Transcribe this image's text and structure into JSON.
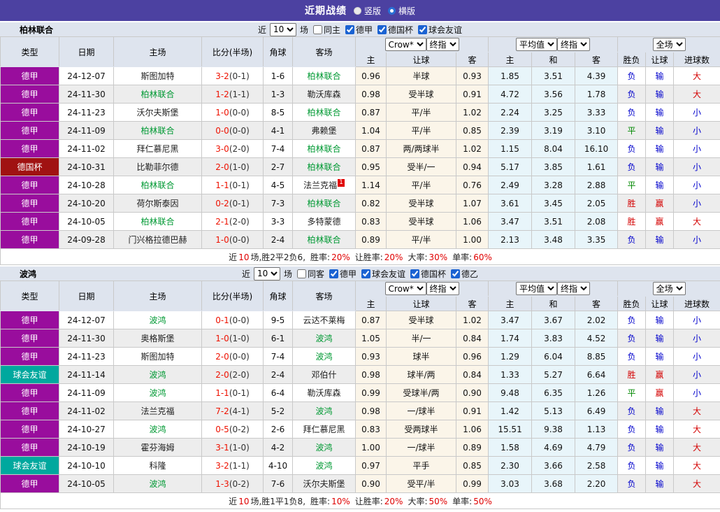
{
  "colors": {
    "topbar_bg": "#4c41a1",
    "panel_bg": "#dee4ee",
    "odds_bg": "#fbf5e9",
    "avg_bg": "#e8f5fa",
    "focus_green": "#009933",
    "score_red": "#ee1100",
    "stat_red": "#e00000",
    "league_colors": {
      "德甲": "#990d9d",
      "德国杯": "#a01212",
      "球会友谊": "#00a89e",
      "德乙": "#1a62d2"
    },
    "result_palette": {
      "red": "#d40000",
      "green": "#008800",
      "blue": "#0000cc"
    }
  },
  "result_color_map": {
    "胜": "red",
    "平": "green",
    "负": "blue",
    "赢": "red",
    "输": "blue",
    "大": "red",
    "小": "blue"
  },
  "topbar": {
    "title": "近期战绩",
    "radios": [
      {
        "label": "竖版",
        "selected": false
      },
      {
        "label": "横版",
        "selected": true
      }
    ]
  },
  "columns": [
    "类型",
    "日期",
    "主场",
    "比分(半场)",
    "角球",
    "客场",
    "主",
    "让球",
    "客",
    "主",
    "和",
    "客",
    "胜负",
    "让球",
    "进球数"
  ],
  "teams": [
    {
      "name": "柏林联合",
      "filter": {
        "near_label": "近",
        "games_value": "10",
        "games_label": "场",
        "same_label": "同主",
        "same_checked": false,
        "leagues": [
          {
            "label": "德甲",
            "checked": true
          },
          {
            "label": "德国杯",
            "checked": true
          },
          {
            "label": "球会友谊",
            "checked": true
          }
        ]
      },
      "dropdowns": {
        "odds_source": "Crow*",
        "odds_final": "终指",
        "avg": "平均值",
        "avg_final": "终指",
        "scope": "全场"
      },
      "rows": [
        {
          "league": "德甲",
          "date": "24-12-07",
          "home": "斯图加特",
          "score": "3-2",
          "half": "0-1",
          "corners": "1-6",
          "away": "柏林联合",
          "focus": "away",
          "home_odds": "0.96",
          "handicap": "半球",
          "away_odds": "0.93",
          "avg_home": "1.85",
          "avg_draw": "3.51",
          "avg_away": "4.39",
          "result": "负",
          "handicap_result": "输",
          "goals_result": "大"
        },
        {
          "league": "德甲",
          "date": "24-11-30",
          "home": "柏林联合",
          "score": "1-2",
          "half": "1-1",
          "corners": "1-3",
          "away": "勒沃库森",
          "focus": "home",
          "home_odds": "0.98",
          "handicap": "受半球",
          "away_odds": "0.91",
          "avg_home": "4.72",
          "avg_draw": "3.56",
          "avg_away": "1.78",
          "result": "负",
          "handicap_result": "输",
          "goals_result": "大"
        },
        {
          "league": "德甲",
          "date": "24-11-23",
          "home": "沃尔夫斯堡",
          "score": "1-0",
          "half": "0-0",
          "corners": "8-5",
          "away": "柏林联合",
          "focus": "away",
          "home_odds": "0.87",
          "handicap": "平/半",
          "away_odds": "1.02",
          "avg_home": "2.24",
          "avg_draw": "3.25",
          "avg_away": "3.33",
          "result": "负",
          "handicap_result": "输",
          "goals_result": "小"
        },
        {
          "league": "德甲",
          "date": "24-11-09",
          "home": "柏林联合",
          "score": "0-0",
          "half": "0-0",
          "corners": "4-1",
          "away": "弗赖堡",
          "focus": "home",
          "home_odds": "1.04",
          "handicap": "平/半",
          "away_odds": "0.85",
          "avg_home": "2.39",
          "avg_draw": "3.19",
          "avg_away": "3.10",
          "result": "平",
          "handicap_result": "输",
          "goals_result": "小"
        },
        {
          "league": "德甲",
          "date": "24-11-02",
          "home": "拜仁慕尼黑",
          "score": "3-0",
          "half": "2-0",
          "corners": "7-4",
          "away": "柏林联合",
          "focus": "away",
          "home_odds": "0.87",
          "handicap": "两/两球半",
          "away_odds": "1.02",
          "avg_home": "1.15",
          "avg_draw": "8.04",
          "avg_away": "16.10",
          "result": "负",
          "handicap_result": "输",
          "goals_result": "小"
        },
        {
          "league": "德国杯",
          "date": "24-10-31",
          "home": "比勒菲尔德",
          "score": "2-0",
          "half": "1-0",
          "corners": "2-7",
          "away": "柏林联合",
          "focus": "away",
          "home_odds": "0.95",
          "handicap": "受半/一",
          "away_odds": "0.94",
          "avg_home": "5.17",
          "avg_draw": "3.85",
          "avg_away": "1.61",
          "result": "负",
          "handicap_result": "输",
          "goals_result": "小"
        },
        {
          "league": "德甲",
          "date": "24-10-28",
          "home": "柏林联合",
          "score": "1-1",
          "half": "0-1",
          "corners": "4-5",
          "away": "法兰克福",
          "away_badge": "1",
          "focus": "home",
          "home_odds": "1.14",
          "handicap": "平/半",
          "away_odds": "0.76",
          "avg_home": "2.49",
          "avg_draw": "3.28",
          "avg_away": "2.88",
          "result": "平",
          "handicap_result": "输",
          "goals_result": "小"
        },
        {
          "league": "德甲",
          "date": "24-10-20",
          "home": "荷尔斯泰因",
          "score": "0-2",
          "half": "0-1",
          "corners": "7-3",
          "away": "柏林联合",
          "focus": "away",
          "home_odds": "0.82",
          "handicap": "受半球",
          "away_odds": "1.07",
          "avg_home": "3.61",
          "avg_draw": "3.45",
          "avg_away": "2.05",
          "result": "胜",
          "handicap_result": "赢",
          "goals_result": "小"
        },
        {
          "league": "德甲",
          "date": "24-10-05",
          "home": "柏林联合",
          "score": "2-1",
          "half": "2-0",
          "corners": "3-3",
          "away": "多特蒙德",
          "focus": "home",
          "home_odds": "0.83",
          "handicap": "受半球",
          "away_odds": "1.06",
          "avg_home": "3.47",
          "avg_draw": "3.51",
          "avg_away": "2.08",
          "result": "胜",
          "handicap_result": "赢",
          "goals_result": "大"
        },
        {
          "league": "德甲",
          "date": "24-09-28",
          "home": "门兴格拉德巴赫",
          "score": "1-0",
          "half": "0-0",
          "corners": "2-4",
          "away": "柏林联合",
          "focus": "away",
          "home_odds": "0.89",
          "handicap": "平/半",
          "away_odds": "1.00",
          "avg_home": "2.13",
          "avg_draw": "3.48",
          "avg_away": "3.35",
          "result": "负",
          "handicap_result": "输",
          "goals_result": "小"
        }
      ],
      "summary": {
        "near": "近",
        "n": "10",
        "tail": "场,胜2平2负6,",
        "stats": [
          {
            "label": "胜率:",
            "value": "20%"
          },
          {
            "label": "让胜率:",
            "value": "20%"
          },
          {
            "label": "大率:",
            "value": "30%"
          },
          {
            "label": "单率:",
            "value": "60%"
          }
        ]
      }
    },
    {
      "name": "波鸿",
      "filter": {
        "near_label": "近",
        "games_value": "10",
        "games_label": "场",
        "same_label": "同客",
        "same_checked": false,
        "leagues": [
          {
            "label": "德甲",
            "checked": true
          },
          {
            "label": "球会友谊",
            "checked": true
          },
          {
            "label": "德国杯",
            "checked": true
          },
          {
            "label": "德乙",
            "checked": true
          }
        ]
      },
      "dropdowns": {
        "odds_source": "Crow*",
        "odds_final": "终指",
        "avg": "平均值",
        "avg_final": "终指",
        "scope": "全场"
      },
      "rows": [
        {
          "league": "德甲",
          "date": "24-12-07",
          "home": "波鸿",
          "score": "0-1",
          "half": "0-0",
          "corners": "9-5",
          "away": "云达不莱梅",
          "focus": "home",
          "home_odds": "0.87",
          "handicap": "受半球",
          "away_odds": "1.02",
          "avg_home": "3.47",
          "avg_draw": "3.67",
          "avg_away": "2.02",
          "result": "负",
          "handicap_result": "输",
          "goals_result": "小"
        },
        {
          "league": "德甲",
          "date": "24-11-30",
          "home": "奥格斯堡",
          "score": "1-0",
          "half": "1-0",
          "corners": "6-1",
          "away": "波鸿",
          "focus": "away",
          "home_odds": "1.05",
          "handicap": "半/一",
          "away_odds": "0.84",
          "avg_home": "1.74",
          "avg_draw": "3.83",
          "avg_away": "4.52",
          "result": "负",
          "handicap_result": "输",
          "goals_result": "小"
        },
        {
          "league": "德甲",
          "date": "24-11-23",
          "home": "斯图加特",
          "score": "2-0",
          "half": "0-0",
          "corners": "7-4",
          "away": "波鸿",
          "focus": "away",
          "home_odds": "0.93",
          "handicap": "球半",
          "away_odds": "0.96",
          "avg_home": "1.29",
          "avg_draw": "6.04",
          "avg_away": "8.85",
          "result": "负",
          "handicap_result": "输",
          "goals_result": "小"
        },
        {
          "league": "球会友谊",
          "date": "24-11-14",
          "home": "波鸿",
          "score": "2-0",
          "half": "2-0",
          "corners": "2-4",
          "away": "邓伯什",
          "focus": "home",
          "home_odds": "0.98",
          "handicap": "球半/两",
          "away_odds": "0.84",
          "avg_home": "1.33",
          "avg_draw": "5.27",
          "avg_away": "6.64",
          "result": "胜",
          "handicap_result": "赢",
          "goals_result": "小"
        },
        {
          "league": "德甲",
          "date": "24-11-09",
          "home": "波鸿",
          "score": "1-1",
          "half": "0-1",
          "corners": "6-4",
          "away": "勒沃库森",
          "focus": "home",
          "home_odds": "0.99",
          "handicap": "受球半/两",
          "away_odds": "0.90",
          "avg_home": "9.48",
          "avg_draw": "6.35",
          "avg_away": "1.26",
          "result": "平",
          "handicap_result": "赢",
          "goals_result": "小"
        },
        {
          "league": "德甲",
          "date": "24-11-02",
          "home": "法兰克福",
          "score": "7-2",
          "half": "4-1",
          "corners": "5-2",
          "away": "波鸿",
          "focus": "away",
          "home_odds": "0.98",
          "handicap": "一/球半",
          "away_odds": "0.91",
          "avg_home": "1.42",
          "avg_draw": "5.13",
          "avg_away": "6.49",
          "result": "负",
          "handicap_result": "输",
          "goals_result": "大"
        },
        {
          "league": "德甲",
          "date": "24-10-27",
          "home": "波鸿",
          "score": "0-5",
          "half": "0-2",
          "corners": "2-6",
          "away": "拜仁慕尼黑",
          "focus": "home",
          "home_odds": "0.83",
          "handicap": "受两球半",
          "away_odds": "1.06",
          "avg_home": "15.51",
          "avg_draw": "9.38",
          "avg_away": "1.13",
          "result": "负",
          "handicap_result": "输",
          "goals_result": "大"
        },
        {
          "league": "德甲",
          "date": "24-10-19",
          "home": "霍芬海姆",
          "score": "3-1",
          "half": "1-0",
          "corners": "4-2",
          "away": "波鸿",
          "focus": "away",
          "home_odds": "1.00",
          "handicap": "一/球半",
          "away_odds": "0.89",
          "avg_home": "1.58",
          "avg_draw": "4.69",
          "avg_away": "4.79",
          "result": "负",
          "handicap_result": "输",
          "goals_result": "大"
        },
        {
          "league": "球会友谊",
          "date": "24-10-10",
          "home": "科隆",
          "score": "3-2",
          "half": "1-1",
          "corners": "4-10",
          "away": "波鸿",
          "focus": "away",
          "home_odds": "0.97",
          "handicap": "平手",
          "away_odds": "0.85",
          "avg_home": "2.30",
          "avg_draw": "3.66",
          "avg_away": "2.58",
          "result": "负",
          "handicap_result": "输",
          "goals_result": "大"
        },
        {
          "league": "德甲",
          "date": "24-10-05",
          "home": "波鸿",
          "score": "1-3",
          "half": "0-2",
          "corners": "7-6",
          "away": "沃尔夫斯堡",
          "focus": "home",
          "home_odds": "0.90",
          "handicap": "受平/半",
          "away_odds": "0.99",
          "avg_home": "3.03",
          "avg_draw": "3.68",
          "avg_away": "2.20",
          "result": "负",
          "handicap_result": "输",
          "goals_result": "大"
        }
      ],
      "summary": {
        "near": "近",
        "n": "10",
        "tail": "场,胜1平1负8,",
        "stats": [
          {
            "label": "胜率:",
            "value": "10%"
          },
          {
            "label": "让胜率:",
            "value": "20%"
          },
          {
            "label": "大率:",
            "value": "50%"
          },
          {
            "label": "单率:",
            "value": "50%"
          }
        ]
      }
    }
  ]
}
